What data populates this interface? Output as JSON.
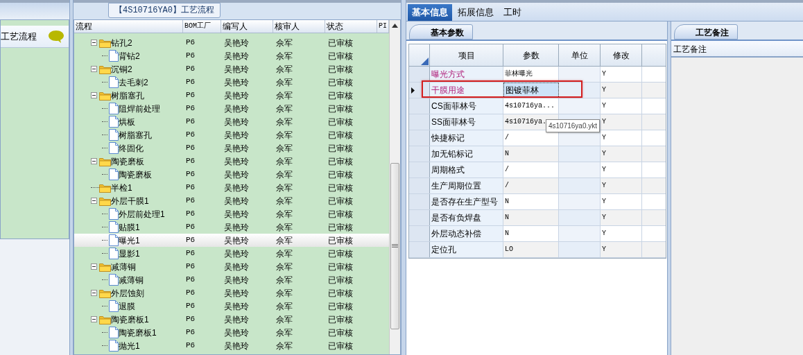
{
  "sidebar": {
    "items": [
      {
        "label": "工艺流程",
        "selected": true
      }
    ]
  },
  "flow_panel": {
    "title": "【4S10716YA0】工艺流程",
    "columns": [
      "流程",
      "BOM工厂",
      "编写人",
      "核审人",
      "状态",
      "PI"
    ],
    "nodes": [
      {
        "label": "钻孔2",
        "kind": "folder",
        "expanded": true,
        "selected": false,
        "bom": "P6",
        "author": "吴艳玲",
        "reviewer": "佘军",
        "status": "已审核",
        "children": [
          {
            "label": "背钻2",
            "kind": "file",
            "selected": false,
            "bom": "P6",
            "author": "吴艳玲",
            "reviewer": "佘军",
            "status": "已审核"
          }
        ]
      },
      {
        "label": "沉铜2",
        "kind": "folder",
        "expanded": true,
        "selected": false,
        "bom": "P6",
        "author": "吴艳玲",
        "reviewer": "佘军",
        "status": "已审核",
        "children": [
          {
            "label": "去毛刺2",
            "kind": "file",
            "selected": false,
            "bom": "P6",
            "author": "吴艳玲",
            "reviewer": "佘军",
            "status": "已审核"
          }
        ]
      },
      {
        "label": "树脂塞孔",
        "kind": "folder",
        "expanded": true,
        "selected": false,
        "bom": "P6",
        "author": "吴艳玲",
        "reviewer": "佘军",
        "status": "已审核",
        "children": [
          {
            "label": "阻焊前处理",
            "kind": "file",
            "selected": false,
            "bom": "P6",
            "author": "吴艳玲",
            "reviewer": "佘军",
            "status": "已审核"
          },
          {
            "label": "烘板",
            "kind": "file",
            "selected": false,
            "bom": "P6",
            "author": "吴艳玲",
            "reviewer": "佘军",
            "status": "已审核"
          },
          {
            "label": "树脂塞孔",
            "kind": "file",
            "selected": false,
            "bom": "P6",
            "author": "吴艳玲",
            "reviewer": "佘军",
            "status": "已审核"
          },
          {
            "label": "终固化",
            "kind": "file",
            "selected": false,
            "bom": "P6",
            "author": "吴艳玲",
            "reviewer": "佘军",
            "status": "已审核"
          }
        ]
      },
      {
        "label": "陶瓷磨板",
        "kind": "folder",
        "expanded": true,
        "selected": false,
        "bom": "P6",
        "author": "吴艳玲",
        "reviewer": "佘军",
        "status": "已审核",
        "children": [
          {
            "label": "陶瓷磨板",
            "kind": "file",
            "selected": false,
            "bom": "P6",
            "author": "吴艳玲",
            "reviewer": "佘军",
            "status": "已审核"
          }
        ]
      },
      {
        "label": "半检1",
        "kind": "folder",
        "selected": false,
        "bom": "P6",
        "author": "吴艳玲",
        "reviewer": "佘军",
        "status": "已审核"
      },
      {
        "label": "外层干膜1",
        "kind": "folder",
        "expanded": true,
        "selected": false,
        "bom": "P6",
        "author": "吴艳玲",
        "reviewer": "佘军",
        "status": "已审核",
        "children": [
          {
            "label": "外层前处理1",
            "kind": "file",
            "selected": false,
            "bom": "P6",
            "author": "吴艳玲",
            "reviewer": "佘军",
            "status": "已审核"
          },
          {
            "label": "贴膜1",
            "kind": "file",
            "selected": false,
            "bom": "P6",
            "author": "吴艳玲",
            "reviewer": "佘军",
            "status": "已审核"
          },
          {
            "label": "曝光1",
            "kind": "file",
            "selected": true,
            "bom": "P6",
            "author": "吴艳玲",
            "reviewer": "佘军",
            "status": "已审核"
          },
          {
            "label": "显影1",
            "kind": "file",
            "selected": false,
            "bom": "P6",
            "author": "吴艳玲",
            "reviewer": "佘军",
            "status": "已审核"
          }
        ]
      },
      {
        "label": "减薄铜",
        "kind": "folder",
        "expanded": true,
        "selected": false,
        "bom": "P6",
        "author": "吴艳玲",
        "reviewer": "佘军",
        "status": "已审核",
        "children": [
          {
            "label": "减薄铜",
            "kind": "file",
            "selected": false,
            "bom": "P6",
            "author": "吴艳玲",
            "reviewer": "佘军",
            "status": "已审核"
          }
        ]
      },
      {
        "label": "外层蚀刻",
        "kind": "folder",
        "expanded": true,
        "selected": false,
        "bom": "P6",
        "author": "吴艳玲",
        "reviewer": "佘军",
        "status": "已审核",
        "children": [
          {
            "label": "退膜",
            "kind": "file",
            "selected": false,
            "bom": "P6",
            "author": "吴艳玲",
            "reviewer": "佘军",
            "status": "已审核"
          }
        ]
      },
      {
        "label": "陶瓷磨板1",
        "kind": "folder",
        "expanded": true,
        "selected": false,
        "bom": "P6",
        "author": "吴艳玲",
        "reviewer": "佘军",
        "status": "已审核",
        "children": [
          {
            "label": "陶瓷磨板1",
            "kind": "file",
            "selected": false,
            "bom": "P6",
            "author": "吴艳玲",
            "reviewer": "佘军",
            "status": "已审核"
          },
          {
            "label": "抛光1",
            "kind": "file",
            "selected": false,
            "bom": "P6",
            "author": "吴艳玲",
            "reviewer": "佘军",
            "status": "已审核"
          }
        ]
      }
    ]
  },
  "detail_tabs": [
    {
      "label": "基本信息",
      "selected": true
    },
    {
      "label": "拓展信息",
      "selected": false
    },
    {
      "label": "工时",
      "selected": false
    }
  ],
  "params_panel": {
    "tab": "基本参数",
    "columns": [
      "项目",
      "参数",
      "单位",
      "修改"
    ],
    "rows": [
      {
        "item": "曝光方式",
        "value": "菲林曝光",
        "modify": "Y",
        "emphasized": true,
        "current": false,
        "outlined": false
      },
      {
        "item": "干膜用途",
        "value": "图镀菲林",
        "modify": "Y",
        "emphasized": true,
        "current": true,
        "outlined": true
      },
      {
        "item": "CS面菲林号",
        "value": "4s10716ya...",
        "modify": "Y",
        "emphasized": false,
        "current": false,
        "outlined": false
      },
      {
        "item": "SS面菲林号",
        "value": "4s10716ya.",
        "modify": "Y",
        "emphasized": false,
        "current": false,
        "outlined": false
      },
      {
        "item": "快捷标记",
        "value": "/",
        "modify": "Y",
        "emphasized": false,
        "current": false,
        "outlined": false
      },
      {
        "item": "加无铅标记",
        "value": "N",
        "modify": "Y",
        "emphasized": false,
        "current": false,
        "outlined": false
      },
      {
        "item": "周期格式",
        "value": "/",
        "modify": "Y",
        "emphasized": false,
        "current": false,
        "outlined": false
      },
      {
        "item": "生产周期位置",
        "value": "/",
        "modify": "Y",
        "emphasized": false,
        "current": false,
        "outlined": false
      },
      {
        "item": "是否存在生产型号",
        "value": "N",
        "modify": "Y",
        "emphasized": false,
        "current": false,
        "outlined": false
      },
      {
        "item": "是否有负焊盘",
        "value": "N",
        "modify": "Y",
        "emphasized": false,
        "current": false,
        "outlined": false
      },
      {
        "item": "外层动态补偿",
        "value": "N",
        "modify": "Y",
        "emphasized": false,
        "current": false,
        "outlined": false
      },
      {
        "item": "定位孔",
        "value": "LO",
        "modify": "Y",
        "emphasized": false,
        "current": false,
        "outlined": false
      }
    ],
    "tooltip": "4s10716ya0.ykt"
  },
  "notes_panel": {
    "tab": "工艺备注",
    "header": "工艺备注"
  }
}
